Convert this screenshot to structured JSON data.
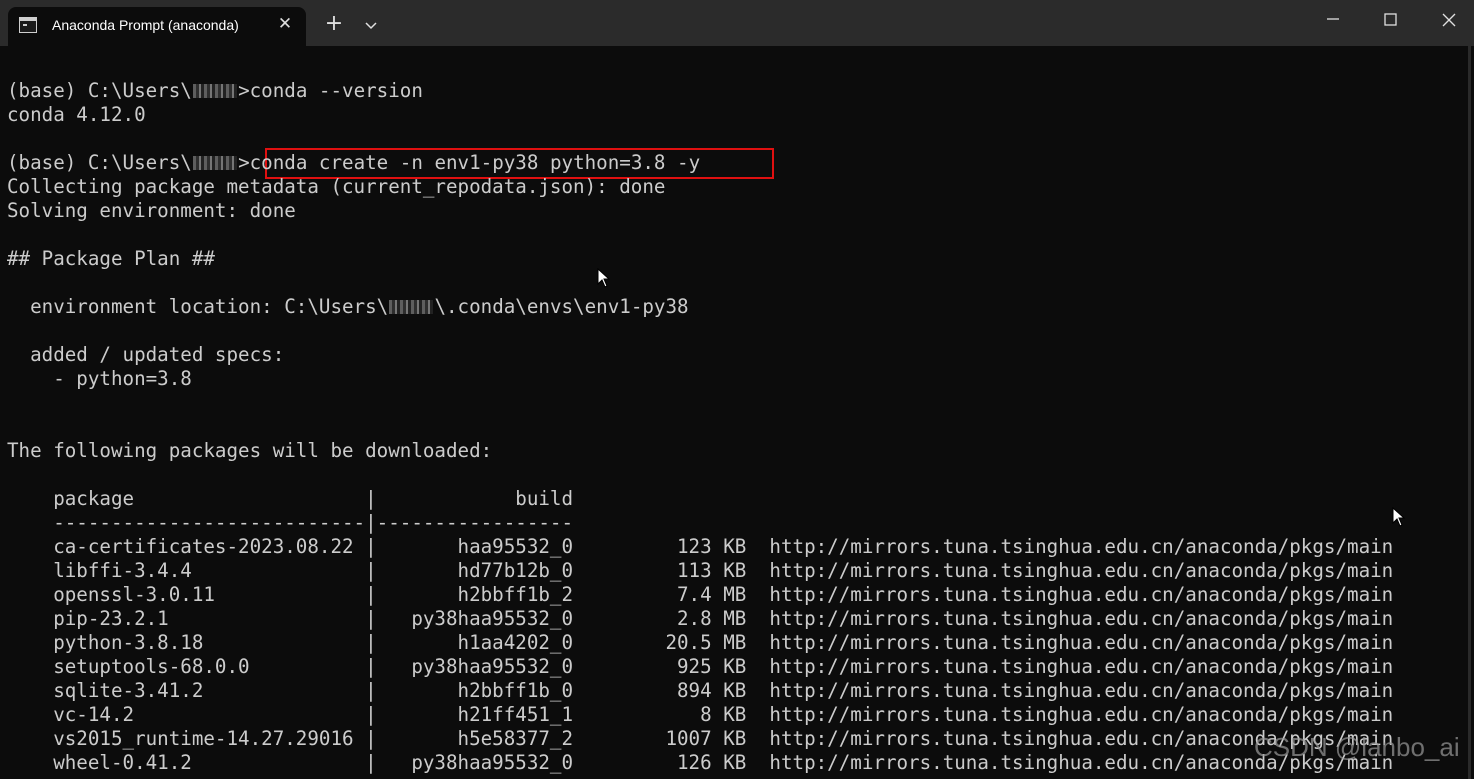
{
  "window": {
    "tab_title": "Anaconda Prompt (anaconda)",
    "icons": {
      "tab": "terminal-icon",
      "close_tab": "close-icon",
      "new_tab": "plus-icon",
      "dropdown": "chevron-down-icon",
      "minimize": "minimize-icon",
      "maximize": "maximize-icon",
      "close_window": "close-icon"
    }
  },
  "terminal": {
    "lines": [
      {
        "pre": "(base) C:\\Users\\",
        "blur": "xxxx",
        "post": ">conda --version"
      },
      {
        "text": "conda 4.12.0"
      },
      {
        "text": ""
      },
      {
        "pre": "(base) C:\\Users\\",
        "blur": "xxxx",
        "post": ">conda create -n env1-py38 python=3.8 -y"
      },
      {
        "text": "Collecting package metadata (current_repodata.json): done"
      },
      {
        "text": "Solving environment: done"
      },
      {
        "text": ""
      },
      {
        "text": "## Package Plan ##"
      },
      {
        "text": ""
      },
      {
        "pre": "  environment location: C:\\Users\\",
        "blur": "xxxx",
        "post": "\\.conda\\envs\\env1-py38"
      },
      {
        "text": ""
      },
      {
        "text": "  added / updated specs:"
      },
      {
        "text": "    - python=3.8"
      },
      {
        "text": ""
      },
      {
        "text": ""
      },
      {
        "text": "The following packages will be downloaded:"
      },
      {
        "text": ""
      },
      {
        "text": "    package                    |            build"
      },
      {
        "text": "    ---------------------------|-----------------"
      },
      {
        "text": "    ca-certificates-2023.08.22 |       haa95532_0         123 KB  http://mirrors.tuna.tsinghua.edu.cn/anaconda/pkgs/main"
      },
      {
        "text": "    libffi-3.4.4               |       hd77b12b_0         113 KB  http://mirrors.tuna.tsinghua.edu.cn/anaconda/pkgs/main"
      },
      {
        "text": "    openssl-3.0.11             |       h2bbff1b_2         7.4 MB  http://mirrors.tuna.tsinghua.edu.cn/anaconda/pkgs/main"
      },
      {
        "text": "    pip-23.2.1                 |   py38haa95532_0         2.8 MB  http://mirrors.tuna.tsinghua.edu.cn/anaconda/pkgs/main"
      },
      {
        "text": "    python-3.8.18              |       h1aa4202_0        20.5 MB  http://mirrors.tuna.tsinghua.edu.cn/anaconda/pkgs/main"
      },
      {
        "text": "    setuptools-68.0.0          |   py38haa95532_0         925 KB  http://mirrors.tuna.tsinghua.edu.cn/anaconda/pkgs/main"
      },
      {
        "text": "    sqlite-3.41.2              |       h2bbff1b_0         894 KB  http://mirrors.tuna.tsinghua.edu.cn/anaconda/pkgs/main"
      },
      {
        "text": "    vc-14.2                    |       h21ff451_1           8 KB  http://mirrors.tuna.tsinghua.edu.cn/anaconda/pkgs/main"
      },
      {
        "text": "    vs2015_runtime-14.27.29016 |       h5e58377_2        1007 KB  http://mirrors.tuna.tsinghua.edu.cn/anaconda/pkgs/main"
      },
      {
        "text": "    wheel-0.41.2               |   py38haa95532_0         126 KB  http://mirrors.tuna.tsinghua.edu.cn/anaconda/pkgs/main"
      }
    ]
  },
  "watermark": "CSDN @lanbo_ai",
  "colors": {
    "terminal_bg": "#0c0c0c",
    "titlebar_bg": "#2b2b2b",
    "text": "#cccccc",
    "highlight_border": "#e01010"
  }
}
